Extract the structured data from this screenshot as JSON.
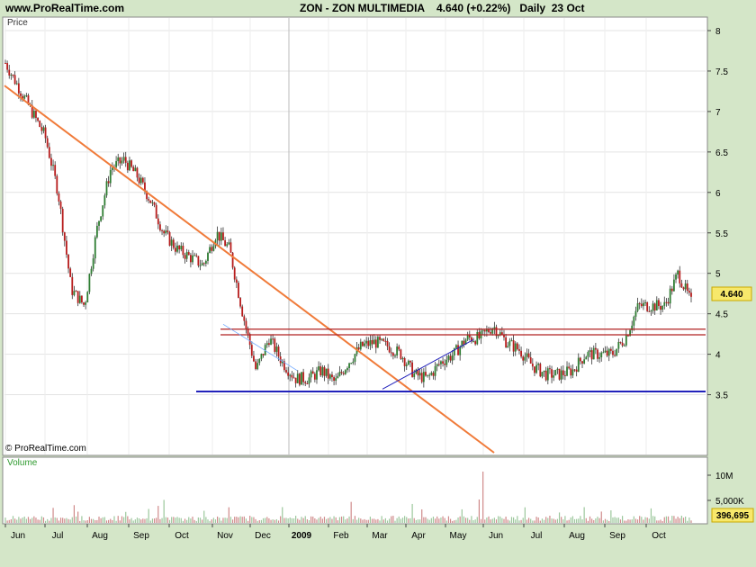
{
  "header": {
    "site": "www.ProRealTime.com",
    "instrument": "ZON - ZON MULTIMEDIA",
    "quote": "4.640 (+0.22%)",
    "period": "Daily  23 Oct"
  },
  "price_panel_label": "Price",
  "volume_panel_label": "Volume",
  "copyright": "© ProRealTime.com",
  "last_price_tag": "4.640",
  "last_volume_tag": "396,695",
  "colors": {
    "up": "#2e7d32",
    "down": "#b71c1c",
    "trend_orange": "#f07b3a",
    "support_blue": "#2222bb",
    "resistance_red": "#b02020",
    "volume_bar": "#cf8a8a"
  },
  "chart_data": [
    {
      "type": "candlestick",
      "panel": "price",
      "x_ticks": [
        "Jun",
        "Jul",
        "Aug",
        "Sep",
        "Oct",
        "Nov",
        "Dec",
        "2009",
        "Feb",
        "Mar",
        "Apr",
        "May",
        "Jun",
        "Jul",
        "Aug",
        "Sep",
        "Oct"
      ],
      "y_ticks": [
        3.5,
        4,
        4.5,
        5,
        5.5,
        6,
        6.5,
        7,
        7.5,
        8
      ],
      "ylim": [
        3.38,
        8.1
      ],
      "series": [
        {
          "values": [
            [
              "Jun",
              7.6
            ],
            [
              "Jun",
              7.3
            ],
            [
              "Jun",
              7.0
            ],
            [
              "Jul",
              6.7
            ],
            [
              "Jul",
              6.0
            ],
            [
              "Jul",
              4.8
            ],
            [
              "Jul",
              4.6
            ],
            [
              "Jul",
              5.6
            ],
            [
              "Aug",
              6.3
            ],
            [
              "Aug",
              6.4
            ],
            [
              "Aug",
              6.2
            ],
            [
              "Aug",
              5.9
            ],
            [
              "Sep",
              5.5
            ],
            [
              "Sep",
              5.3
            ],
            [
              "Sep",
              5.2
            ],
            [
              "Sep",
              5.1
            ],
            [
              "Oct",
              5.5
            ],
            [
              "Oct",
              5.3
            ],
            [
              "Oct",
              4.5
            ],
            [
              "Oct",
              3.8
            ],
            [
              "Nov",
              4.2
            ],
            [
              "Nov",
              3.9
            ],
            [
              "Nov",
              3.7
            ],
            [
              "Dec",
              3.7
            ],
            [
              "Dec",
              3.8
            ],
            [
              "Dec",
              3.65
            ],
            [
              "2009",
              3.9
            ],
            [
              "2009",
              4.1
            ],
            [
              "Feb",
              4.15
            ],
            [
              "Feb",
              4.1
            ],
            [
              "Feb",
              4.0
            ],
            [
              "Mar",
              3.75
            ],
            [
              "Mar",
              3.7
            ],
            [
              "Mar",
              3.9
            ],
            [
              "Apr",
              4.0
            ],
            [
              "Apr",
              4.2
            ],
            [
              "Apr",
              4.2
            ],
            [
              "May",
              4.35
            ],
            [
              "May",
              4.15
            ],
            [
              "May",
              4.05
            ],
            [
              "Jun",
              3.85
            ],
            [
              "Jun",
              3.75
            ],
            [
              "Jul",
              3.75
            ],
            [
              "Jul",
              3.8
            ],
            [
              "Aug",
              4.0
            ],
            [
              "Aug",
              4.0
            ],
            [
              "Aug",
              4.0
            ],
            [
              "Sep",
              4.2
            ],
            [
              "Sep",
              4.6
            ],
            [
              "Sep",
              4.6
            ],
            [
              "Oct",
              4.6
            ],
            [
              "Oct",
              5.0
            ],
            [
              "Oct",
              4.64
            ]
          ]
        }
      ],
      "trendlines": [
        {
          "kind": "downtrend",
          "from": [
            "Jun",
            7.3
          ],
          "to": [
            "Jun",
            3.2
          ]
        },
        {
          "kind": "support",
          "level": 3.54
        },
        {
          "kind": "resistance",
          "level": 4.31
        },
        {
          "kind": "resistance",
          "level": 4.24
        }
      ]
    },
    {
      "type": "bar",
      "panel": "volume",
      "y_ticks": [
        "10M",
        "5,000K"
      ],
      "series": [
        {
          "values": []
        }
      ]
    }
  ]
}
